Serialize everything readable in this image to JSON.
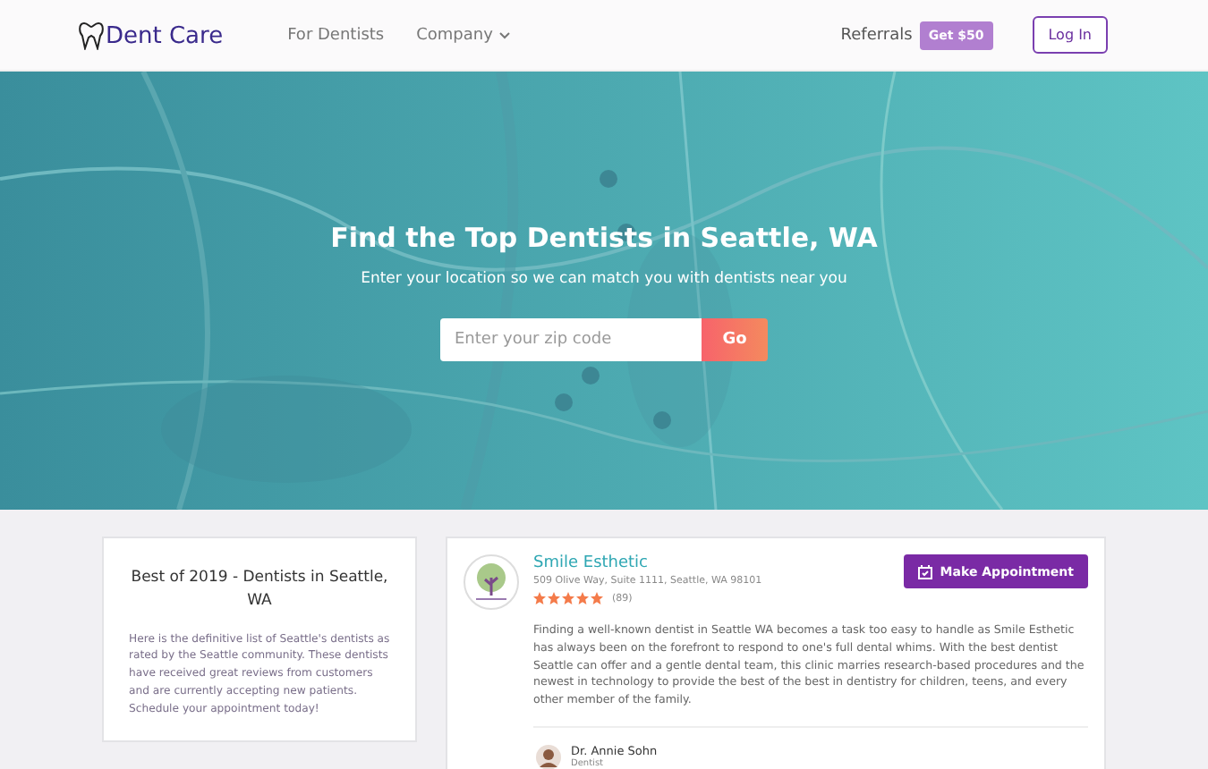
{
  "header": {
    "logo": "Dent Care",
    "nav": [
      {
        "label": "For Dentists",
        "kind": "link"
      },
      {
        "label": "Company",
        "kind": "dropdown"
      }
    ],
    "referrals": "Referrals",
    "referral_badge": "Get $50",
    "login": "Log In"
  },
  "hero": {
    "kind": "picture",
    "title": "Find the Top Dentists in Seattle, WA",
    "subtitle": "Enter your location so we can match you with dentists near you",
    "search": {
      "placeholder": "Enter your zip code"
    },
    "go": "Go"
  },
  "intro_card": {
    "title": "Best of 2019 - Dentists in Seattle, WA",
    "text": "Here is the definitive list of Seattle's dentists as rated by the Seattle community. These dentists have received great reviews from customers and are currently accepting new patients. Schedule your appointment today!"
  },
  "listing": {
    "name": "Smile Esthetic",
    "address": "509 Olive Way, Suite 1111, Seattle, WA 98101",
    "stars": 5,
    "review_count": "(89)",
    "button": "Make Appointment",
    "description": "Finding a well-known dentist in Seattle WA becomes a task too easy to handle as Smile Esthetic has always been on the forefront to respond to one's full dental whims. With the best dentist Seattle can offer and a gentle dental team, this clinic marries research-based procedures and the newest in technology to provide the best of the best in dentistry for children, teens, and every other member of the family.",
    "dentist": {
      "name": "Dr. Annie Sohn",
      "role": "Dentist"
    }
  }
}
